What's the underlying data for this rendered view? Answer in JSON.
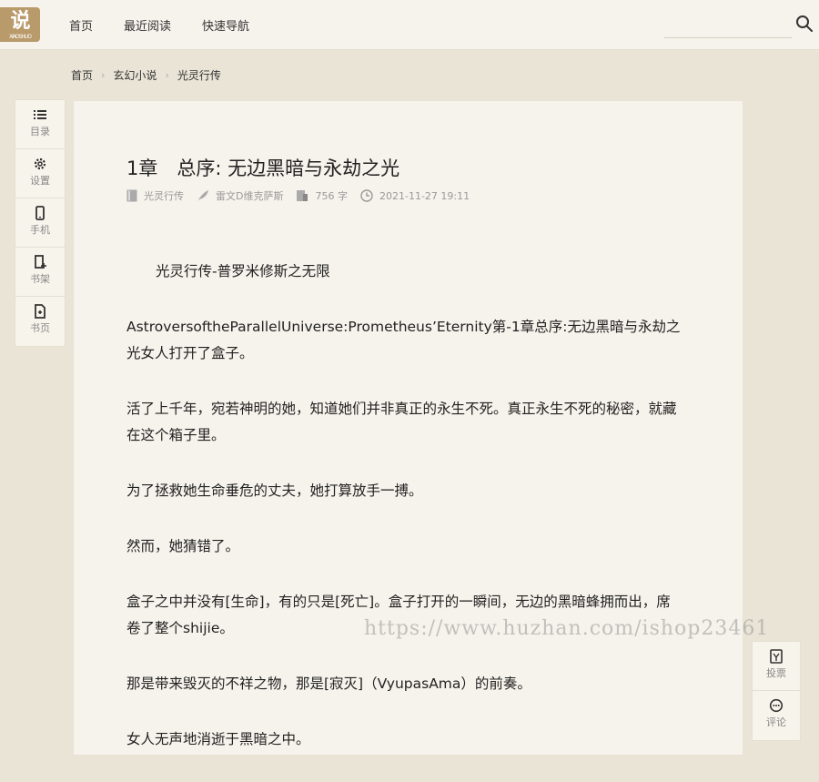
{
  "header": {
    "logo_text": "说",
    "logo_sub": "XIAOSHUO",
    "nav": [
      "首页",
      "最近阅读",
      "快速导航"
    ],
    "search_placeholder": ""
  },
  "breadcrumb": [
    "首页",
    "玄幻小说",
    "光灵行传"
  ],
  "left_toolbar": [
    "目录",
    "设置",
    "手机",
    "书架",
    "书页"
  ],
  "right_toolbar": [
    "投票",
    "评论"
  ],
  "chapter": {
    "title": "1章　总序: 无边黑暗与永劫之光",
    "book": "光灵行传",
    "author": "雷文D维克萨斯",
    "word_count": "756 字",
    "date": "2021-11-27 19:11"
  },
  "paragraphs": [
    "光灵行传-普罗米修斯之无限",
    "AstroversoftheParallelUniverse:Prometheus’Eternity第-1章总序:无边黑暗与永劫之光女人打开了盒子。",
    "活了上千年，宛若神明的她，知道她们并非真正的永生不死。真正永生不死的秘密，就藏在这个箱子里。",
    "为了拯救她生命垂危的丈夫，她打算放手一搏。",
    "然而，她猜错了。",
    "盒子之中并没有[生命]，有的只是[死亡]。盒子打开的一瞬间，无边的黑暗蜂拥而出，席卷了整个shijie。",
    "那是带来毁灭的不祥之物，那是[寂灭]（VyupasAma）的前奏。",
    "女人无声地消逝于黑暗之中。"
  ],
  "watermark": "https://www.huzhan.com/ishop23461"
}
